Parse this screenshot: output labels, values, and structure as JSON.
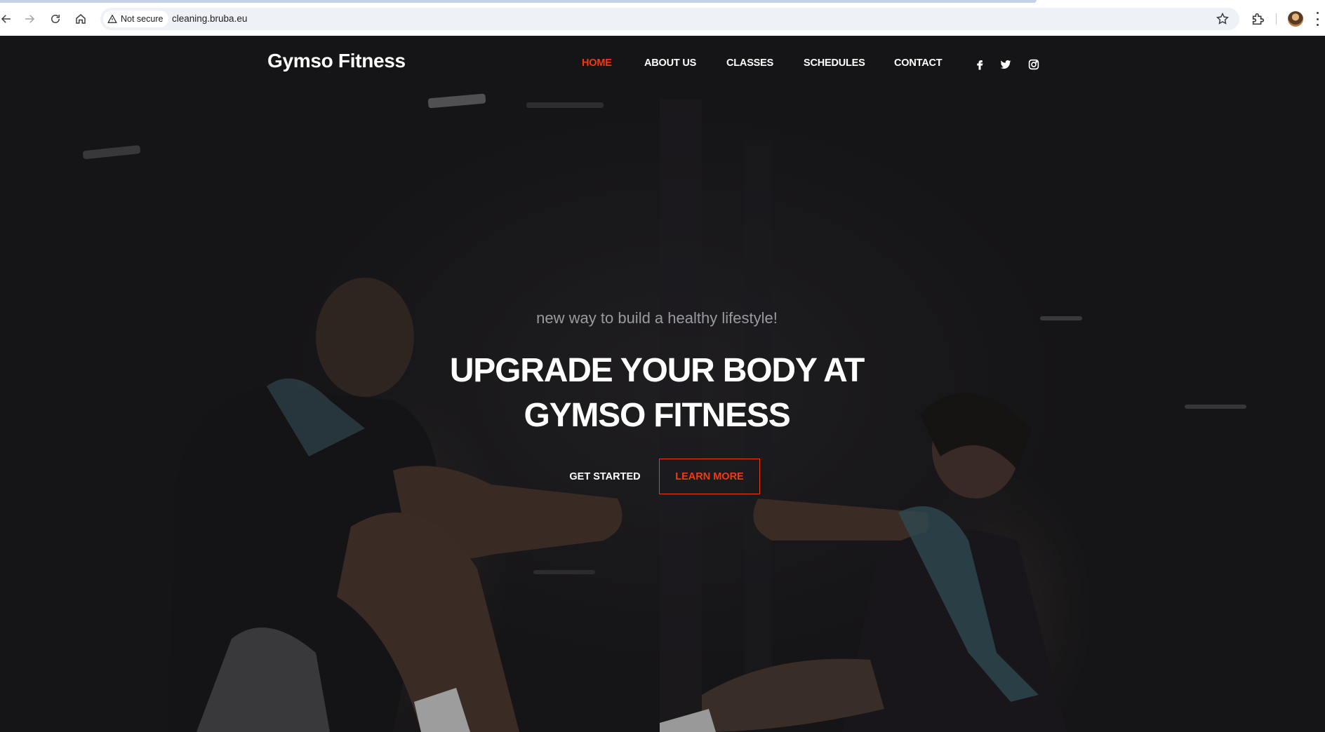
{
  "browser": {
    "security_label": "Not secure",
    "url": "cleaning.bruba.eu",
    "icons": [
      "back-arrow-icon",
      "forward-arrow-icon",
      "reload-icon",
      "home-icon",
      "warning-triangle-icon",
      "bookmark-star-icon",
      "extensions-puzzle-icon",
      "profile-avatar",
      "more-vert-icon"
    ]
  },
  "site": {
    "brand": "Gymso Fitness",
    "nav": [
      {
        "label": "HOME",
        "active": true
      },
      {
        "label": "ABOUT US",
        "active": false
      },
      {
        "label": "CLASSES",
        "active": false
      },
      {
        "label": "SCHEDULES",
        "active": false
      },
      {
        "label": "CONTACT",
        "active": false
      }
    ],
    "social": [
      "facebook-icon",
      "twitter-icon",
      "instagram-icon"
    ]
  },
  "hero": {
    "subtitle": "new way to build a healthy lifestyle!",
    "title_line1": "UPGRADE YOUR BODY AT",
    "title_line2": "GYMSO FITNESS",
    "primary_button": "GET STARTED",
    "secondary_button": "LEARN MORE"
  },
  "colors": {
    "accent": "#f13a11",
    "background": "#1b1a1c",
    "text": "#ffffff"
  }
}
